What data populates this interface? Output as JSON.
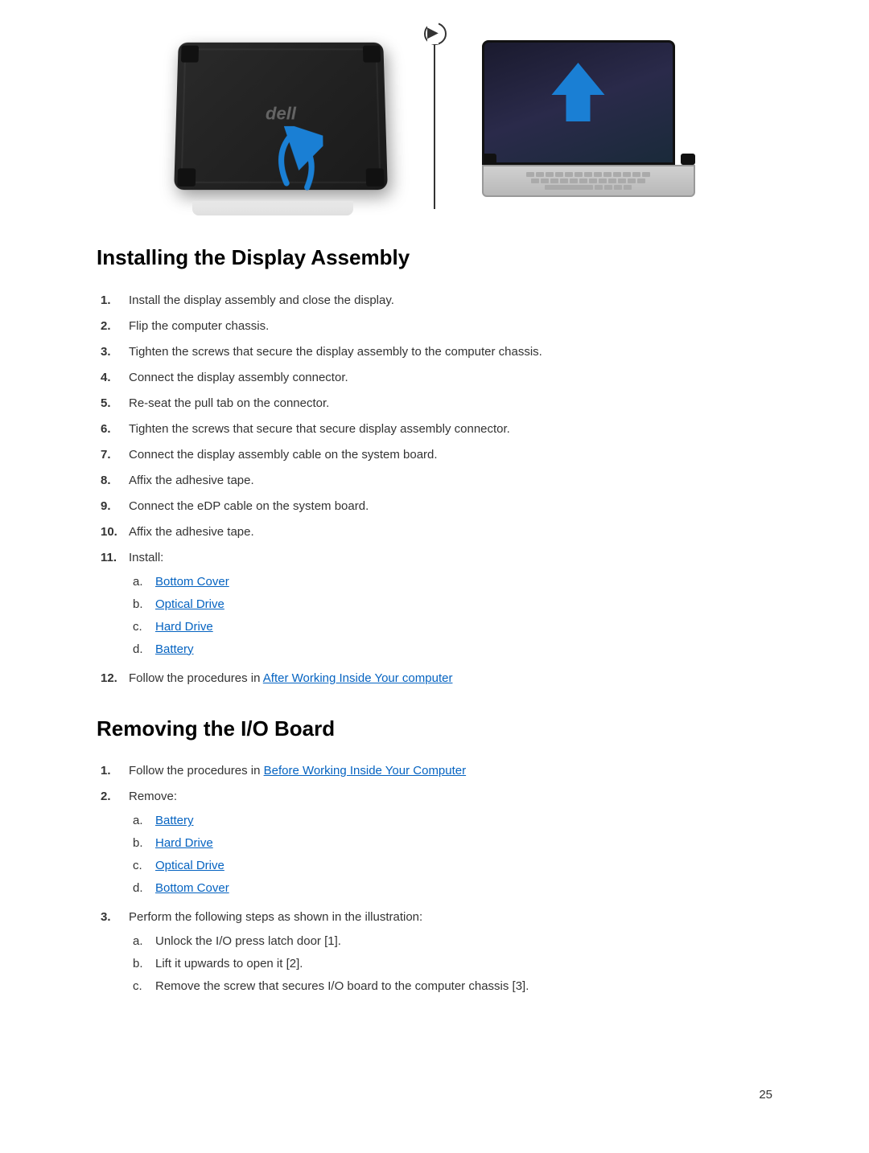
{
  "images": {
    "left_alt": "Tablet back view with upward arrow",
    "right_alt": "Laptop view with upward arrow"
  },
  "installing_section": {
    "title": "Installing the Display Assembly",
    "steps": [
      {
        "num": "1.",
        "text": "Install the display assembly and close the display."
      },
      {
        "num": "2.",
        "text": "Flip the computer chassis."
      },
      {
        "num": "3.",
        "text": "Tighten the screws that secure the display assembly to the computer chassis."
      },
      {
        "num": "4.",
        "text": "Connect the display assembly connector."
      },
      {
        "num": "5.",
        "text": "Re-seat the pull tab on the connector."
      },
      {
        "num": "6.",
        "text": "Tighten the screws that secure that secure display assembly connector."
      },
      {
        "num": "7.",
        "text": "Connect the display assembly cable on the system board."
      },
      {
        "num": "8.",
        "text": "Affix the adhesive tape."
      },
      {
        "num": "9.",
        "text": "Connect the eDP cable on the system board."
      },
      {
        "num": "10.",
        "text": "Affix the adhesive tape."
      },
      {
        "num": "11.",
        "text": "Install:"
      }
    ],
    "install_sub": [
      {
        "label": "a.",
        "text": "Bottom Cover",
        "link": true
      },
      {
        "label": "b.",
        "text": "Optical Drive",
        "link": true
      },
      {
        "label": "c.",
        "text": "Hard Drive",
        "link": true
      },
      {
        "label": "d.",
        "text": "Battery",
        "link": true
      }
    ],
    "step_12_prefix": "12.",
    "step_12_text": "Follow the procedures in ",
    "step_12_link": "After Working Inside Your computer",
    "step_12_suffix": ""
  },
  "removing_section": {
    "title": "Removing the I/O Board",
    "step1_prefix": "1.",
    "step1_text": "Follow the procedures in ",
    "step1_link": "Before Working Inside Your Computer",
    "step2_num": "2.",
    "step2_text": "Remove:",
    "remove_sub": [
      {
        "label": "a.",
        "text": "Battery",
        "link": true
      },
      {
        "label": "b.",
        "text": "Hard Drive",
        "link": true
      },
      {
        "label": "c.",
        "text": "Optical Drive",
        "link": true
      },
      {
        "label": "d.",
        "text": "Bottom Cover",
        "link": true
      }
    ],
    "step3_num": "3.",
    "step3_text": "Perform the following steps as shown in the illustration:",
    "step3_sub": [
      {
        "label": "a.",
        "text": "Unlock the I/O press latch door [1]."
      },
      {
        "label": "b.",
        "text": "Lift it upwards to open it [2]."
      },
      {
        "label": "c.",
        "text": "Remove the screw that secures I/O board to the computer chassis [3]."
      }
    ]
  },
  "page_number": "25"
}
